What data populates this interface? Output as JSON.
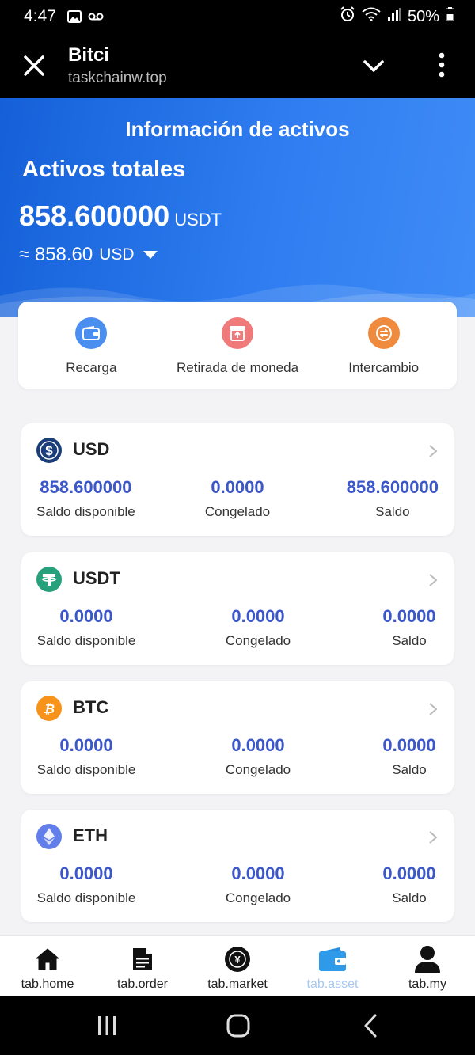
{
  "status_bar": {
    "time": "4:47",
    "battery": "50%"
  },
  "browser": {
    "title": "Bitci",
    "url": "taskchainw.top"
  },
  "hero": {
    "heading": "Información de activos",
    "total_label": "Activos totales",
    "total_amount": "858.600000",
    "total_unit": "USDT",
    "approx_amount": "≈ 858.60",
    "approx_unit": "USD"
  },
  "actions": [
    {
      "label": "Recarga",
      "icon": "wallet-icon",
      "color": "#4a8ff0"
    },
    {
      "label": "Retirada de moneda",
      "icon": "withdraw-icon",
      "color": "#f07a7a"
    },
    {
      "label": "Intercambio",
      "icon": "exchange-icon",
      "color": "#f08a3c"
    }
  ],
  "coins": [
    {
      "name": "USD",
      "available": "858.600000",
      "available_label": "Saldo disponible",
      "frozen": "0.0000",
      "frozen_label": "Congelado",
      "balance": "858.600000",
      "balance_label": "Saldo",
      "icon": "dollar-icon",
      "color": "#1b3d7a"
    },
    {
      "name": "USDT",
      "available": "0.0000",
      "available_label": "Saldo disponible",
      "frozen": "0.0000",
      "frozen_label": "Congelado",
      "balance": "0.0000",
      "balance_label": "Saldo",
      "icon": "tether-icon",
      "color": "#26a17b"
    },
    {
      "name": "BTC",
      "available": "0.0000",
      "available_label": "Saldo disponible",
      "frozen": "0.0000",
      "frozen_label": "Congelado",
      "balance": "0.0000",
      "balance_label": "Saldo",
      "icon": "bitcoin-icon",
      "color": "#f7931a"
    },
    {
      "name": "ETH",
      "available": "0.0000",
      "available_label": "Saldo disponible",
      "frozen": "0.0000",
      "frozen_label": "Congelado",
      "balance": "0.0000",
      "balance_label": "Saldo",
      "icon": "ethereum-icon",
      "color": "#627eea"
    }
  ],
  "tabs": [
    {
      "label": "tab.home",
      "icon": "home-icon",
      "active": false
    },
    {
      "label": "tab.order",
      "icon": "document-icon",
      "active": false
    },
    {
      "label": "tab.market",
      "icon": "market-icon",
      "active": false
    },
    {
      "label": "tab.asset",
      "icon": "wallet-icon",
      "active": true
    },
    {
      "label": "tab.my",
      "icon": "person-icon",
      "active": false
    }
  ],
  "colors": {
    "accent": "#3c57c9",
    "hero": "#2e7cf0",
    "active_tab": "#a9c8f0"
  }
}
